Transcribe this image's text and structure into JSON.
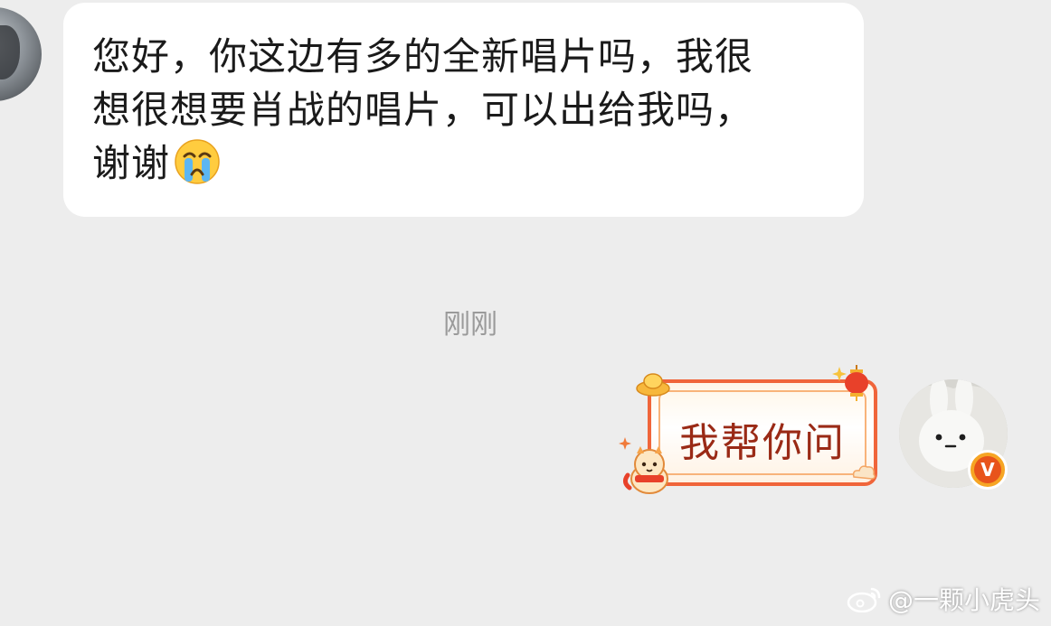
{
  "chat": {
    "incoming": {
      "text_line1": "您好，你这边有多的全新唱片吗，我很",
      "text_line2": "想很想要肖战的唱片，可以出给我吗，",
      "text_line3": "谢谢",
      "emoji": "loudly-crying-face-icon"
    },
    "timestamp": "刚刚",
    "outgoing": {
      "text": "我帮你问",
      "badge": "V"
    }
  },
  "watermark": {
    "text": "@一颗小虎头",
    "icon": "weibo-logo"
  },
  "colors": {
    "background": "#ededed",
    "bubble_in": "#ffffff",
    "bubble_out_border": "#f0653a",
    "bubble_out_text": "#9a2a16",
    "timestamp": "#9a9a9a",
    "badge": "#e8541b"
  }
}
